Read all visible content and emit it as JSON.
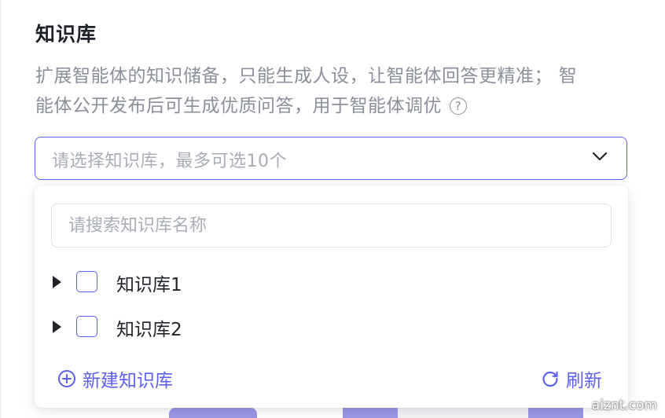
{
  "section": {
    "title": "知识库",
    "description_line1": "扩展智能体的知识储备，只能生成人设，让智能体回答更精准； 智",
    "description_line2": "能体公开发布后可生成优质问答，用于智能体调优",
    "help_glyph": "?"
  },
  "select": {
    "placeholder": "请选择知识库，最多可选10个"
  },
  "dropdown": {
    "search_placeholder": "请搜索知识库名称",
    "items": [
      {
        "label": "知识库1"
      },
      {
        "label": "知识库2"
      }
    ],
    "create_label": "新建知识库",
    "refresh_label": "刷新"
  },
  "colors": {
    "accent": "#5d5fef",
    "text": "#1f2329",
    "muted": "#8a8f99",
    "placeholder": "#a8adb6",
    "thumbnail": "#9a98e6"
  },
  "watermark": "aiznt.com"
}
